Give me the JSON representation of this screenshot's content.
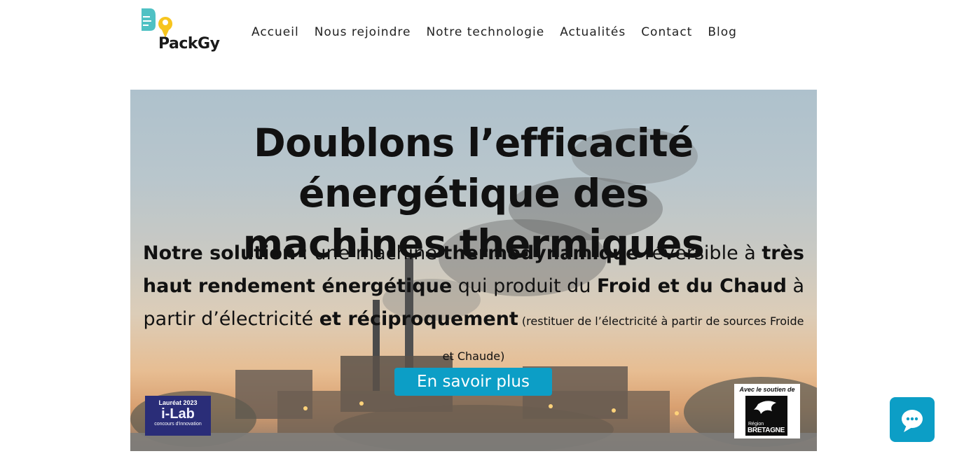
{
  "header": {
    "logo_text": "PackGy",
    "nav": [
      "Accueil",
      "Nous rejoindre",
      "Notre technologie",
      "Actualités",
      "Contact",
      "Blog"
    ]
  },
  "hero": {
    "title_line1": "Doublons l’efficacité énergétique des",
    "title_line2": "machines thermiques",
    "sub": {
      "p1_bold": "Notre solution",
      "p1_rest": " : une machine ",
      "p2_bold": "thermodynamique",
      "p2_rest": " réversible à ",
      "p3_bold": "très haut rendement énergétique",
      "p3_rest": " qui produit du ",
      "p4_bold": "Froid et du Chaud",
      "p4_rest": " à partir d’électricité ",
      "p5_bold": "et réciproquement",
      "p5_small": " (restituer de l’électricité à partir de sources Froide et Chaude)"
    },
    "cta_label": "En savoir plus"
  },
  "badges": {
    "ilab_top": "Lauréat 2023",
    "ilab_mid": "i-Lab",
    "ilab_bot": "concours d'innovation",
    "bretagne_top": "Avec le soutien de",
    "bretagne_region": "Région",
    "bretagne_name": "BRETAGNE"
  },
  "colors": {
    "accent": "#0c9ec6",
    "logo_teal": "#4fc1c4",
    "logo_yellow": "#f7c51e",
    "ilab_bg": "#2a2d78"
  },
  "icons": {
    "chat": "chat-bubble-icon",
    "logo": "packgy-logo-icon"
  }
}
